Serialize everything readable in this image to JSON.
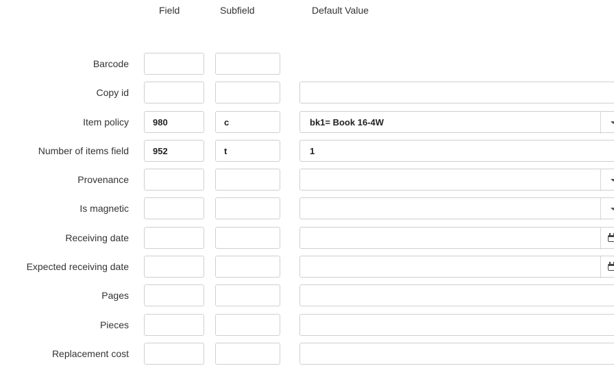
{
  "headers": {
    "field": "Field",
    "subfield": "Subfield",
    "default_value": "Default Value"
  },
  "rows": [
    {
      "label": "Barcode",
      "field": "",
      "subfield": "",
      "default": "",
      "control": "none"
    },
    {
      "label": "Copy id",
      "field": "",
      "subfield": "",
      "default": "",
      "control": "text"
    },
    {
      "label": "Item policy",
      "field": "980",
      "subfield": "c",
      "default": "bk1= Book 16-4W",
      "control": "select"
    },
    {
      "label": "Number of items field",
      "field": "952",
      "subfield": "t",
      "default": "1",
      "control": "text"
    },
    {
      "label": "Provenance",
      "field": "",
      "subfield": "",
      "default": "",
      "control": "select"
    },
    {
      "label": "Is magnetic",
      "field": "",
      "subfield": "",
      "default": "",
      "control": "select"
    },
    {
      "label": "Receiving date",
      "field": "",
      "subfield": "",
      "default": "",
      "control": "date"
    },
    {
      "label": "Expected receiving date",
      "field": "",
      "subfield": "",
      "default": "",
      "control": "date"
    },
    {
      "label": "Pages",
      "field": "",
      "subfield": "",
      "default": "",
      "control": "text"
    },
    {
      "label": "Pieces",
      "field": "",
      "subfield": "",
      "default": "",
      "control": "text"
    },
    {
      "label": "Replacement cost",
      "field": "",
      "subfield": "",
      "default": "",
      "control": "text"
    }
  ],
  "icons": {
    "select": "chevron-down-icon",
    "date": "calendar-icon"
  }
}
